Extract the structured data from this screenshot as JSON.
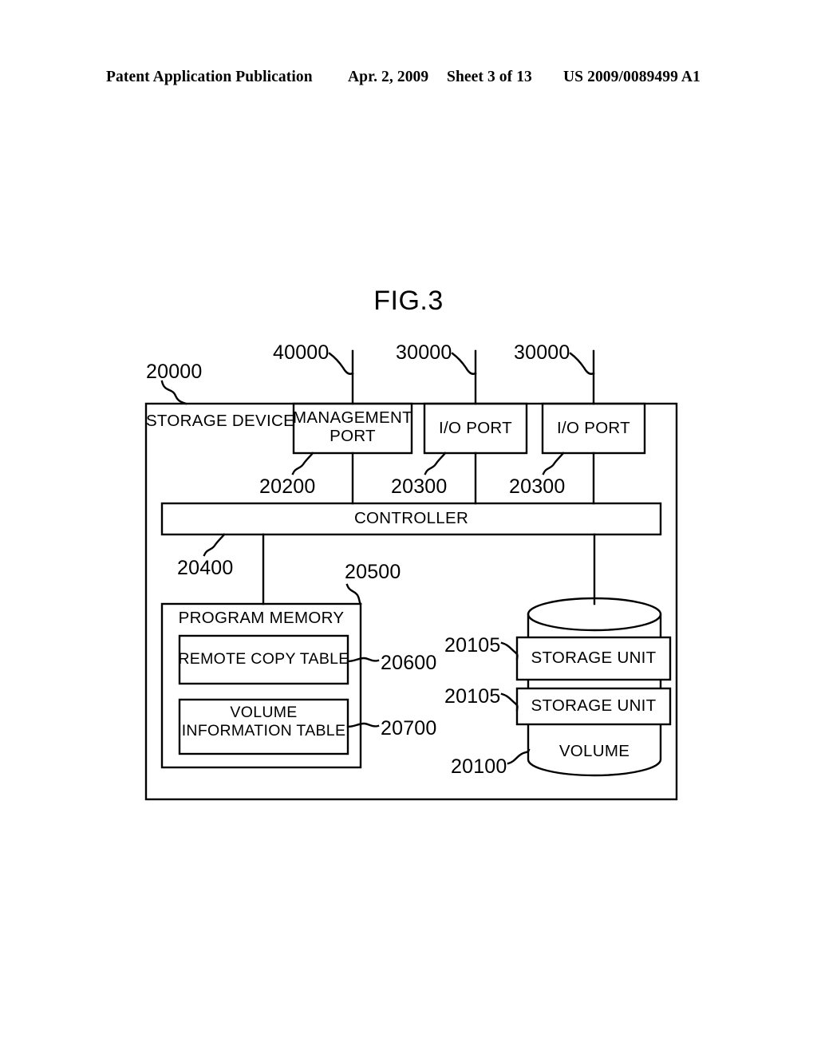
{
  "header": {
    "publication": "Patent Application Publication",
    "date": "Apr. 2, 2009",
    "sheet": "Sheet 3 of 13",
    "patent_number": "US 2009/0089499 A1"
  },
  "figure": {
    "title": "FIG.3"
  },
  "diagram": {
    "boxes": {
      "storage_device": "STORAGE DEVICE",
      "management_port": "MANAGEMENT\nPORT",
      "management_port_line1": "MANAGEMENT",
      "management_port_line2": "PORT",
      "io_port_1": "I/O PORT",
      "io_port_2": "I/O PORT",
      "controller": "CONTROLLER",
      "program_memory": "PROGRAM MEMORY",
      "remote_copy_table": "REMOTE COPY TABLE",
      "volume_information_table_line1": "VOLUME",
      "volume_information_table_line2": "INFORMATION TABLE",
      "storage_unit_1": "STORAGE UNIT",
      "storage_unit_2": "STORAGE UNIT",
      "volume": "VOLUME"
    },
    "reference_numerals": {
      "storage_device": "20000",
      "management_port_top": "40000",
      "io_port_1_top": "30000",
      "io_port_2_top": "30000",
      "management_port": "20200",
      "io_port_1": "20300",
      "io_port_2": "20300",
      "controller": "20400",
      "program_memory": "20500",
      "remote_copy_table": "20600",
      "volume_information_table": "20700",
      "storage_unit_1": "20105",
      "storage_unit_2": "20105",
      "volume": "20100"
    },
    "colors": {
      "line": "#000000",
      "background": "#ffffff"
    }
  }
}
